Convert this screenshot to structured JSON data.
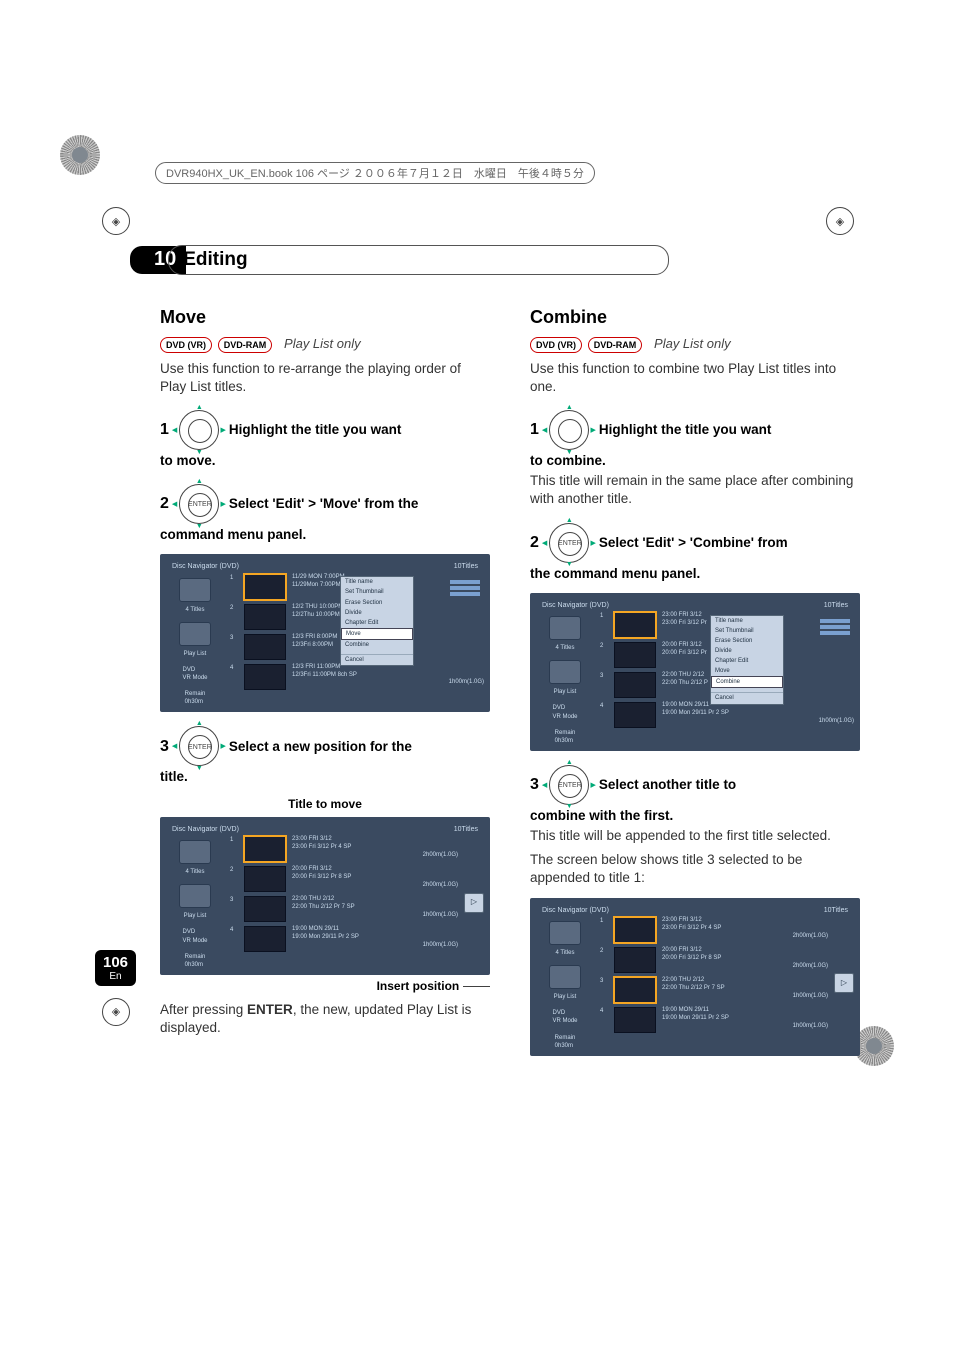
{
  "header": {
    "book_line": "DVR940HX_UK_EN.book  106 ページ  ２００６年７月１２日　水曜日　午後４時５分"
  },
  "chapter": {
    "number": "10",
    "title": "Editing"
  },
  "move": {
    "heading": "Move",
    "badges": [
      "DVD (VR)",
      "DVD-RAM"
    ],
    "note": "Play List only",
    "intro": "Use this function to re-arrange the playing order of Play List titles.",
    "step1": "Highlight the title you want",
    "step1_cont": "to move.",
    "step2": "Select 'Edit' > 'Move' from the",
    "step2_cont": "command menu panel.",
    "step3": "Select a new position for the",
    "step3_cont": "title.",
    "label_title_to_move": "Title to move",
    "label_insert_pos": "Insert position",
    "after_enter_pre": "After pressing ",
    "after_enter_bold": "ENTER",
    "after_enter_post": ", the new, updated Play List is displayed."
  },
  "combine": {
    "heading": "Combine",
    "badges": [
      "DVD (VR)",
      "DVD-RAM"
    ],
    "note": "Play List only",
    "intro": "Use this function to combine two Play List titles into one.",
    "step1": "Highlight the title you want",
    "step1_cont": "to combine.",
    "step1_note": "This title will remain in the same place after combining with another title.",
    "step2": "Select 'Edit' > 'Combine' from",
    "step2_cont": "the command menu panel.",
    "step3": "Select another title to",
    "step3_cont": "combine with the first.",
    "step3_note1": "This title will be appended to the first title selected.",
    "step3_note2": "The screen below shows title 3 selected to be appended to title 1:"
  },
  "ui": {
    "title_bar": "Disc Navigator (DVD)",
    "count": "10Titles",
    "side_titles": "4 Titles",
    "side_playlist": "Play List",
    "side_mode": "DVD\nVR Mode",
    "side_remain": "Remain\n0h30m",
    "menu": {
      "items": [
        "Title name",
        "Set Thumbnail",
        "Erase Section",
        "Divide",
        "Chapter Edit",
        "Move",
        "Combine"
      ],
      "cancel": "Cancel"
    },
    "rows_a": [
      {
        "n": "1",
        "h": "11/29  MON  7:00PM",
        "s": "11/29Mon  7:00PM"
      },
      {
        "n": "2",
        "h": "12/2  THU  10:00PM",
        "s": "12/2Thu 10:00PM"
      },
      {
        "n": "3",
        "h": "12/3  FRI  8:00PM",
        "s": "12/3Fri  8:00PM"
      },
      {
        "n": "4",
        "h": "12/3  FRI  11:00PM",
        "s": "12/3Fri  11:00PM   8ch   SP",
        "extra": "1h00m(1.0G)"
      }
    ],
    "rows_b": [
      {
        "n": "1",
        "h": "23:00  FRI  3/12",
        "s": "23:00  Fri  3/12  Pr 4  SP",
        "extra": "2h00m(1.0G)"
      },
      {
        "n": "2",
        "h": "20:00  FRI  3/12",
        "s": "20:00  Fri  3/12  Pr 8  SP",
        "extra": "2h00m(1.0G)"
      },
      {
        "n": "3",
        "h": "22:00  THU  2/12",
        "s": "22:00  Thu  2/12  Pr 7  SP",
        "extra": "1h00m(1.0G)"
      },
      {
        "n": "4",
        "h": "19:00  MON  29/11",
        "s": "19:00   Mon  29/11   Pr 2  SP",
        "extra": "1h00m(1.0G)"
      }
    ],
    "rows_c": [
      {
        "n": "1",
        "h": "23:00  FRI  3/12",
        "s": "23:00  Fri  3/12  Pr"
      },
      {
        "n": "2",
        "h": "20:00  FRI  3/12",
        "s": "20:00  Fri  3/12  Pr"
      },
      {
        "n": "3",
        "h": "22:00  THU  2/12",
        "s": "22:00  Thu  2/12  P"
      },
      {
        "n": "4",
        "h": "19:00  MON  29/11",
        "s": "19:00   Mon  29/11   Pr 2  SP",
        "extra": "1h00m(1.0G)"
      }
    ]
  },
  "page_number": {
    "num": "106",
    "lang": "En"
  }
}
